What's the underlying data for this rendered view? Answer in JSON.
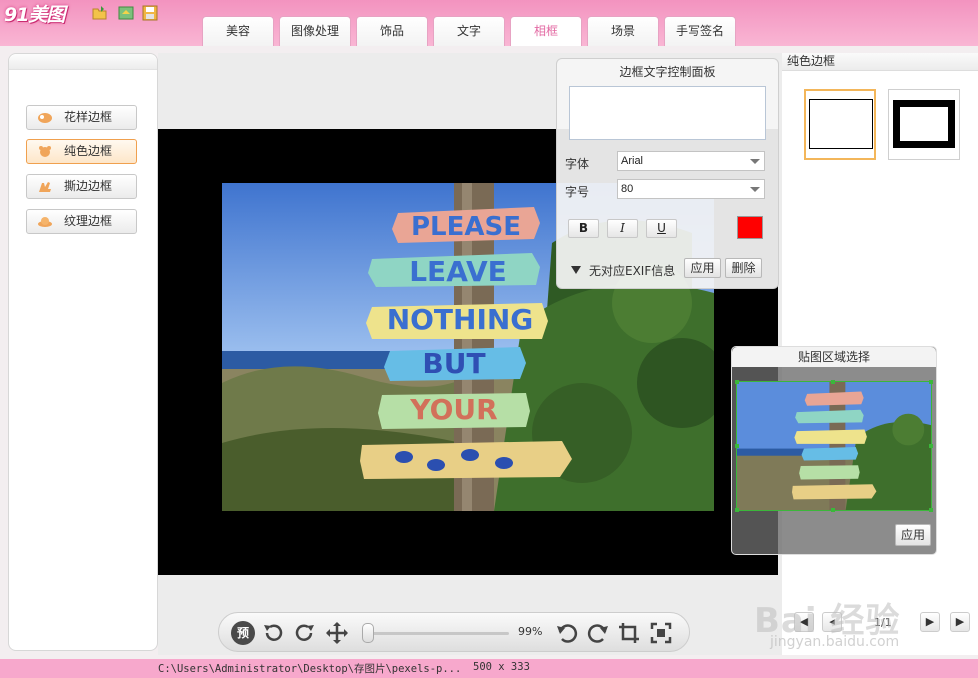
{
  "app": {
    "logo": "91美图"
  },
  "toolbar": {
    "icons": [
      "open-folder-icon",
      "export-icon",
      "save-icon"
    ]
  },
  "tabs": [
    {
      "label": "美容",
      "active": false
    },
    {
      "label": "图像处理",
      "active": false
    },
    {
      "label": "饰品",
      "active": false
    },
    {
      "label": "文字",
      "active": false
    },
    {
      "label": "相框",
      "active": true
    },
    {
      "label": "场景",
      "active": false
    },
    {
      "label": "手写签名",
      "active": false
    }
  ],
  "sidebar": {
    "items": [
      {
        "label": "花样边框",
        "icon": "flower-icon",
        "selected": false
      },
      {
        "label": "纯色边框",
        "icon": "bear-icon",
        "selected": true
      },
      {
        "label": "撕边边框",
        "icon": "hand-icon",
        "selected": false
      },
      {
        "label": "纹理边框",
        "icon": "hat-icon",
        "selected": false
      }
    ]
  },
  "control_panel": {
    "title": "边框文字控制面板",
    "text_value": "",
    "font_label": "字体",
    "font_value": "Arial",
    "size_label": "字号",
    "size_value": "80",
    "bold_label": "B",
    "italic_label": "I",
    "underline_label": "U",
    "text_color": "#ff0000",
    "exif_label": "无对应EXIF信息",
    "apply_label": "应用",
    "delete_label": "删除"
  },
  "region_panel": {
    "title": "贴图区域选择",
    "apply_label": "应用"
  },
  "right_panel": {
    "title": "纯色边框",
    "page_indicator": "1/1"
  },
  "bottom_toolbar": {
    "preview_label": "预",
    "zoom": "99%",
    "zoom_fraction": 0.0
  },
  "status": {
    "path": "C:\\Users\\Administrator\\Desktop\\存图片\\pexels-p...",
    "dimensions": "500 x 333"
  },
  "photo": {
    "signs": [
      "PLEASE",
      "LEAVE",
      "NOTHING",
      "BUT",
      "YOUR"
    ]
  },
  "watermark": {
    "text": "Bai 经验",
    "url": "jingyan.baidu.com"
  },
  "colors": {
    "accent_pink": "#f7a6cc",
    "selected_orange": "#f0a04e",
    "active_tab_text": "#e36aa3"
  }
}
